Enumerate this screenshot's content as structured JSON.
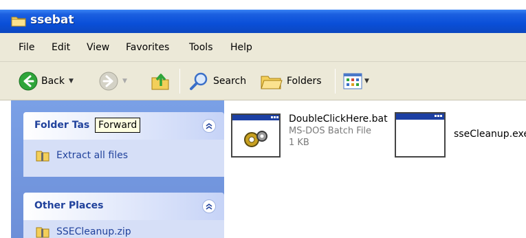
{
  "window": {
    "title": "ssebat"
  },
  "menu": [
    "File",
    "Edit",
    "View",
    "Favorites",
    "Tools",
    "Help"
  ],
  "toolbar": {
    "back_label": "Back",
    "search_label": "Search",
    "folders_label": "Folders"
  },
  "tooltip": "Forward",
  "task_pane": {
    "folder_tasks": {
      "title": "Folder Tas",
      "items": [
        "Extract all files"
      ]
    },
    "other_places": {
      "title": "Other Places",
      "items": [
        "SSECleanup.zip"
      ]
    }
  },
  "files": [
    {
      "name": "DoubleClickHere.bat",
      "type": "MS-DOS Batch File",
      "size": "1 KB",
      "icon": "batch-file-icon"
    },
    {
      "name": "sseCleanup.exe",
      "icon": "exe-file-icon"
    }
  ]
}
